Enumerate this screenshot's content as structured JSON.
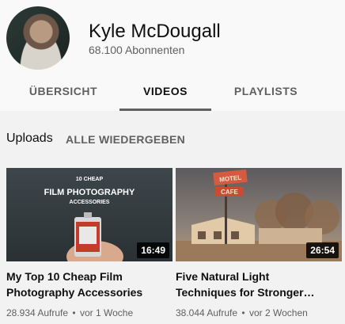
{
  "channel": {
    "name": "Kyle McDougall",
    "subscribers": "68.100 Abonnenten"
  },
  "tabs": [
    {
      "label": "ÜBERSICHT",
      "active": false
    },
    {
      "label": "VIDEOS",
      "active": true
    },
    {
      "label": "PLAYLISTS",
      "active": false
    }
  ],
  "section": {
    "title": "Uploads",
    "play_all": "ALLE WIEDERGEBEN"
  },
  "videos": [
    {
      "thumbnail_text": [
        "10 CHEAP",
        "FILM PHOTOGRAPHY",
        "ACCESSORIES"
      ],
      "duration": "16:49",
      "title_lines": [
        "My Top 10 Cheap Film",
        "Photography Accessories"
      ],
      "views": "28.934 Aufrufe",
      "age": "vor 1 Woche"
    },
    {
      "thumbnail_text": [
        "MOTEL",
        "CAFE"
      ],
      "duration": "26:54",
      "title_lines": [
        "Five Natural Light",
        "Techniques for Stronger…"
      ],
      "views": "38.044 Aufrufe",
      "age": "vor 2 Wochen"
    }
  ],
  "meta_separator": "•",
  "colors": {
    "header_bg": "#f9f9f9",
    "page_bg": "#f2f2f2",
    "secondary_text": "#606060"
  }
}
